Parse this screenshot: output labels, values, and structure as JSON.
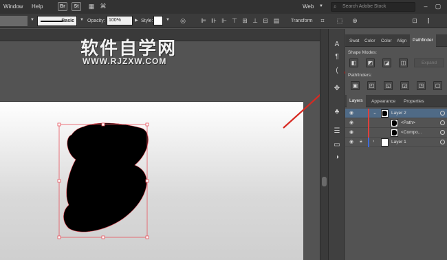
{
  "menubar": {
    "items": [
      "Window",
      "Help"
    ],
    "app_buttons": [
      "Br",
      "St"
    ],
    "workspace": "Web",
    "search_placeholder": "Search Adobe Stock"
  },
  "control_bar": {
    "stroke_profile": "Basic",
    "opacity_label": "Opacity:",
    "opacity_value": "100%",
    "style_label": "Style:",
    "transform_label": "Transform"
  },
  "watermark": {
    "title": "软件自学网",
    "url": "WWW.RJZXW.COM"
  },
  "tools": [
    "A",
    "¶",
    "(",
    "✥",
    "♣",
    "☰",
    "▭",
    "◑"
  ],
  "panel_tabs": [
    {
      "label": "Swat",
      "active": false
    },
    {
      "label": "Color",
      "active": false
    },
    {
      "label": "Color",
      "active": false
    },
    {
      "label": "Align",
      "active": false
    },
    {
      "label": "Pathfinder",
      "active": true
    }
  ],
  "pathfinder": {
    "shape_modes_label": "Shape Modes:",
    "pathfinders_label": "Pathfinders:",
    "expand_label": "Expand"
  },
  "layers_tabs": [
    {
      "label": "Layers",
      "active": true
    },
    {
      "label": "Appearance",
      "active": false
    },
    {
      "label": "Properties",
      "active": false
    }
  ],
  "layers": [
    {
      "name": "Layer 2",
      "level": 0,
      "selected": true,
      "bar_color": "#e0403c",
      "expanded": true,
      "locked": false
    },
    {
      "name": "<Path>",
      "level": 1,
      "selected": false,
      "bar_color": "#e0403c",
      "expanded": false,
      "locked": false
    },
    {
      "name": "<Compo...",
      "level": 1,
      "selected": false,
      "bar_color": "#e0403c",
      "expanded": false,
      "locked": false
    },
    {
      "name": "Layer 1",
      "level": 0,
      "selected": false,
      "bar_color": "#3f6bd9",
      "expanded": false,
      "locked": true
    }
  ],
  "colors": {
    "annotation_arrow": "#d72a22",
    "selection_bounds": "#e8525c",
    "layer_selected_bg": "#4f6a86"
  }
}
